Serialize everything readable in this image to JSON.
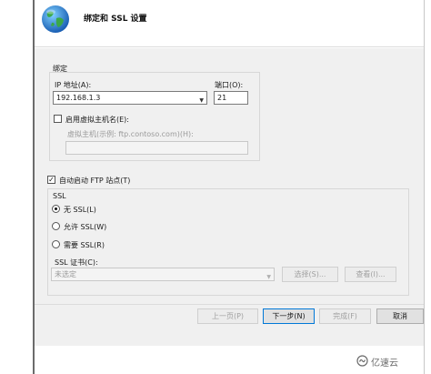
{
  "dialog": {
    "title": "绑定和 SSL 设置",
    "binding": {
      "group_label": "绑定",
      "ip_label": "IP 地址(A):",
      "ip_value": "192.168.1.3",
      "port_label": "端口(O):",
      "port_value": "21",
      "virtual_host_checkbox_label": "启用虚拟主机名(E):",
      "virtual_host_checked": false,
      "virtual_host_field_label": "虚拟主机(示例: ftp.contoso.com)(H):",
      "virtual_host_value": ""
    },
    "auto_start": {
      "label": "自动启动 FTP 站点(T)",
      "checked": true
    },
    "ssl": {
      "group_label": "SSL",
      "options": [
        {
          "label": "无 SSL(L)",
          "selected": true
        },
        {
          "label": "允许 SSL(W)",
          "selected": false
        },
        {
          "label": "需要 SSL(R)",
          "selected": false
        }
      ],
      "cert_label": "SSL 证书(C):",
      "cert_value": "未选定",
      "select_button": "选择(S)...",
      "view_button": "查看(I)..."
    },
    "buttons": {
      "prev": "上一页(P)",
      "next": "下一步(N)",
      "finish": "完成(F)",
      "cancel": "取消"
    }
  },
  "watermark": {
    "text": "亿速云"
  },
  "colors": {
    "dialog_bg": "#f0f0f0",
    "accent": "#0078d7",
    "disabled_text": "#9a9a9a"
  }
}
